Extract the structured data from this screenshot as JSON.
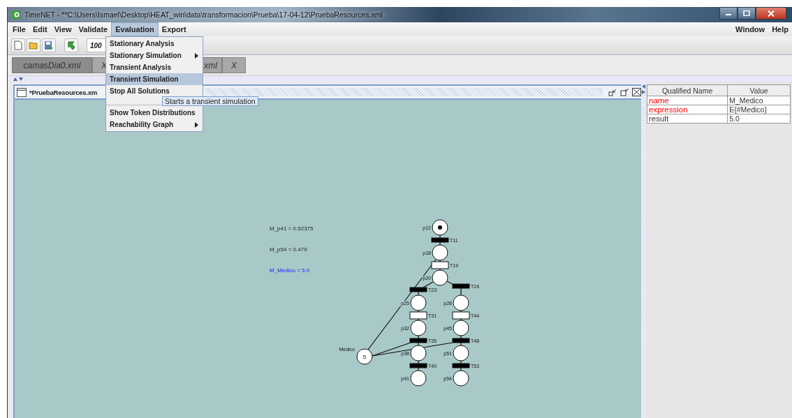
{
  "window": {
    "title": "TimeNET - **C:\\Users\\Ismael\\Desktop\\HEAT_win\\data\\transformacion\\Prueba\\17-04-12\\PruebaResources.xml"
  },
  "menu_bar": {
    "left": [
      {
        "label": "File",
        "selected": false
      },
      {
        "label": "Edit",
        "selected": false
      },
      {
        "label": "View",
        "selected": false
      },
      {
        "label": "Validate",
        "selected": false
      },
      {
        "label": "Evaluation",
        "selected": true
      },
      {
        "label": "Export",
        "selected": false
      }
    ],
    "right": [
      {
        "label": "Window",
        "selected": false
      },
      {
        "label": "Help",
        "selected": false
      }
    ]
  },
  "evaluation_menu": [
    {
      "kind": "item",
      "label": "Stationary Analysis",
      "selected": false
    },
    {
      "kind": "submenu",
      "label": "Stationary Simulation",
      "selected": false
    },
    {
      "kind": "item",
      "label": "Transient Analysis",
      "selected": false
    },
    {
      "kind": "item",
      "label": "Transient Simulation",
      "selected": true
    },
    {
      "kind": "item",
      "label": "Stop All Solutions",
      "selected": false
    },
    {
      "kind": "separator"
    },
    {
      "kind": "item",
      "label": "Show Token Distributions",
      "selected": false
    },
    {
      "kind": "submenu",
      "label": "Reachability Graph",
      "selected": false
    }
  ],
  "tooltip": "Starts a transient simulation",
  "toolbar": {
    "zoom": "100"
  },
  "tabs": [
    {
      "label": "camasDia0.xml",
      "close": "X"
    },
    {
      "label": "xml",
      "close": "X"
    }
  ],
  "document": {
    "title": "*PruebaResources.xm",
    "annotations": [
      {
        "text": "M_p41 = 0.52375",
        "highlighted": false
      },
      {
        "text": "M_p54 = 0.479",
        "highlighted": false
      },
      {
        "text": "M_Medico = 5.0",
        "highlighted": true
      }
    ],
    "places": [
      {
        "name": "p12",
        "marked": true
      },
      {
        "name": "p18",
        "marked": false
      },
      {
        "name": "p20",
        "marked": false
      },
      {
        "name": "p25",
        "marked": false
      },
      {
        "name": "p28",
        "marked": false
      },
      {
        "name": "p32",
        "marked": false
      },
      {
        "name": "p45",
        "marked": false
      },
      {
        "name": "p38",
        "marked": false
      },
      {
        "name": "p51",
        "marked": false
      },
      {
        "name": "p41",
        "marked": false
      },
      {
        "name": "p54",
        "marked": false
      }
    ],
    "resource": {
      "name": "Medico",
      "value": "5"
    },
    "transitions": [
      {
        "name": "T11",
        "kind": "immediate"
      },
      {
        "name": "T19",
        "kind": "timed"
      },
      {
        "name": "T23",
        "kind": "immediate"
      },
      {
        "name": "T24",
        "kind": "immediate"
      },
      {
        "name": "T31",
        "kind": "timed"
      },
      {
        "name": "T44",
        "kind": "timed"
      },
      {
        "name": "T35",
        "kind": "immediate"
      },
      {
        "name": "T48",
        "kind": "immediate"
      },
      {
        "name": "T40",
        "kind": "immediate"
      },
      {
        "name": "T53",
        "kind": "immediate"
      }
    ]
  },
  "properties": {
    "columns": [
      "Qualified Name",
      "Value"
    ],
    "rows": [
      {
        "name": "name",
        "value": "M_Medico",
        "color": "#ff0000"
      },
      {
        "name": "expression",
        "value": "E{#Medico}",
        "color": "#ff0000"
      },
      {
        "name": "result",
        "value": "5.0",
        "color": "#333333"
      }
    ]
  }
}
